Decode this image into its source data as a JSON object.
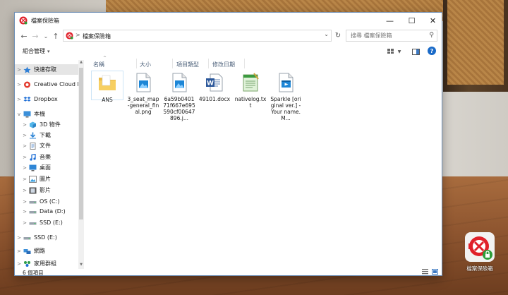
{
  "window": {
    "title": "檔案保險箱",
    "minimize_glyph": "—",
    "maximize_glyph": "☐",
    "close_glyph": "✕"
  },
  "address_bar": {
    "back_glyph": "←",
    "forward_glyph": "→",
    "recent_glyph": "⌄",
    "up_glyph": "↑",
    "separator": ">",
    "crumb": "檔案保險箱",
    "dropdown_glyph": "⌄",
    "refresh_glyph": "↻"
  },
  "search": {
    "placeholder": "搜尋 檔案保險箱",
    "icon_glyph": "⚲"
  },
  "toolbar": {
    "organize_label": "組合管理",
    "organize_caret": "▾",
    "help_glyph": "?"
  },
  "columns": [
    {
      "label": "名稱"
    },
    {
      "label": "大小"
    },
    {
      "label": "項目類型"
    },
    {
      "label": "修改日期"
    }
  ],
  "sort_glyph": "^",
  "nav_items": [
    {
      "label": "快速存取",
      "chevron": ">",
      "icon": "star-icon",
      "selected": true
    },
    {
      "label": "Creative Cloud Fi",
      "chevron": ">",
      "icon": "creative-cloud-icon"
    },
    {
      "label": "Dropbox",
      "chevron": ">",
      "icon": "dropbox-icon"
    },
    {
      "label": "本機",
      "chevron": "v",
      "icon": "computer-icon"
    },
    {
      "label": "3D 物件",
      "chevron": ">",
      "icon": "3d-objects-icon"
    },
    {
      "label": "下載",
      "chevron": ">",
      "icon": "downloads-icon"
    },
    {
      "label": "文件",
      "chevron": ">",
      "icon": "documents-icon"
    },
    {
      "label": "音樂",
      "chevron": ">",
      "icon": "music-icon"
    },
    {
      "label": "桌面",
      "chevron": ">",
      "icon": "desktop-icon"
    },
    {
      "label": "圖片",
      "chevron": ">",
      "icon": "pictures-icon"
    },
    {
      "label": "影片",
      "chevron": ">",
      "icon": "videos-icon"
    },
    {
      "label": "OS (C:)",
      "chevron": ">",
      "icon": "drive-icon"
    },
    {
      "label": "Data (D:)",
      "chevron": ">",
      "icon": "drive-icon"
    },
    {
      "label": "SSD (E:)",
      "chevron": ">",
      "icon": "drive-icon"
    },
    {
      "label": "SSD (E:)",
      "chevron": ">",
      "icon": "drive-icon"
    },
    {
      "label": "網路",
      "chevron": ">",
      "icon": "network-icon"
    },
    {
      "label": "家用群組",
      "chevron": ">",
      "icon": "homegroup-icon"
    }
  ],
  "files": [
    {
      "name": "ANS",
      "type": "folder-icon"
    },
    {
      "name": "3_seat_map-general_final.png",
      "type": "image-file-icon"
    },
    {
      "name": "6a59b040171f667e695590cf00647896.j...",
      "type": "image-file-icon"
    },
    {
      "name": "49101.docx",
      "type": "word-doc-icon"
    },
    {
      "name": "nativelog.txt",
      "type": "notepad-icon"
    },
    {
      "name": "Sparkle [original ver.] -Your name. M...",
      "type": "video-file-icon"
    }
  ],
  "status": {
    "item_count": "6 個項目"
  },
  "shortcut": {
    "label": "檔案保險箱"
  },
  "colors": {
    "accent": "#1a6ac8",
    "vault_red": "#e0202a",
    "lock_green": "#2e9e3a"
  }
}
